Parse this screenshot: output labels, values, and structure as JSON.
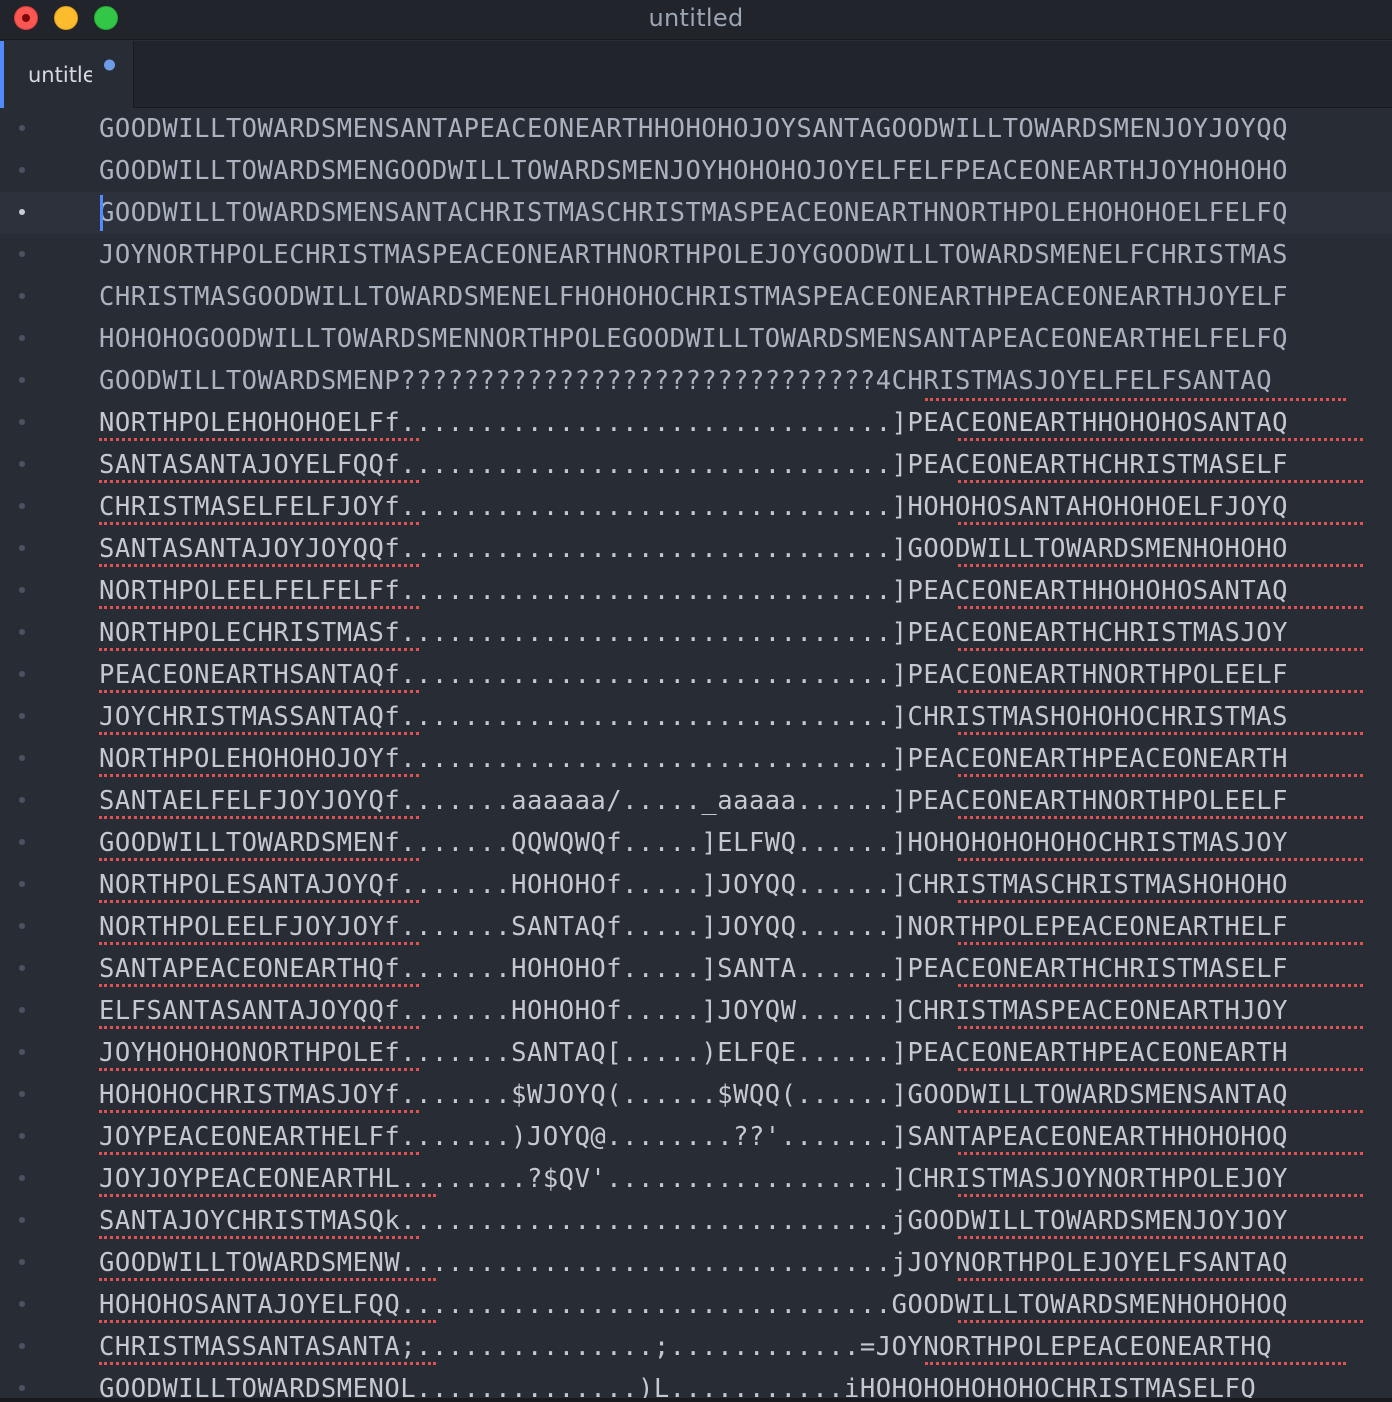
{
  "window": {
    "title": "untitled"
  },
  "tabs": [
    {
      "label": "untitled",
      "modified": true
    }
  ],
  "editor": {
    "current_line": 3,
    "lines": [
      "GOODWILLTOWARDSMENSANTAPEACEONEARTHHOHOHOJOYSANTAGOODWILLTOWARDSMENJOYJOYQQ",
      "GOODWILLTOWARDSMENGOODWILLTOWARDSMENJOYHOHOHOJOYELFELFPEACEONEARTHJOYHOHOHO",
      "GOODWILLTOWARDSMENSANTACHRISTMASCHRISTMASPEACEONEARTHNORTHPOLEHOHOHOELFELFQ",
      "JOYNORTHPOLECHRISTMASPEACEONEARTHNORTHPOLEJOYGOODWILLTOWARDSMENELFCHRISTMAS",
      "CHRISTMASGOODWILLTOWARDSMENELFHOHOHOCHRISTMASPEACEONEARTHPEACEONEARTHJOYELF",
      "HOHOHOGOODWILLTOWARDSMENNORTHPOLEGOODWILLTOWARDSMENSANTAPEACEONEARTHELFELFQ",
      "GOODWILLTOWARDSMENP??????????????????????????????4CHRISTMASJOYELFELFSANTAQ",
      "NORTHPOLEHOHOHOELFf...............................]PEACEONEARTHHOHOHOSANTAQ",
      "SANTASANTAJOYELFQQf...............................]PEACEONEARTHCHRISTMASELF",
      "CHRISTMASELFELFJOYf...............................]HOHOHOSANTAHOHOHOELFJOYQ",
      "SANTASANTAJOYJOYQQf...............................]GOODWILLTOWARDSMENHOHOHO",
      "NORTHPOLEELFELFELFf...............................]PEACEONEARTHHOHOHOSANTAQ",
      "NORTHPOLECHRISTMASf...............................]PEACEONEARTHCHRISTMASJOY",
      "PEACEONEARTHSANTAQf...............................]PEACEONEARTHNORTHPOLEELF",
      "JOYCHRISTMASSANTAQf...............................]CHRISTMASHOHOHOCHRISTMAS",
      "NORTHPOLEHOHOHOJOYf...............................]PEACEONEARTHPEACEONEARTH",
      "SANTAELFELFJOYJOYQf.......aaaaaa/....._aaaaa......]PEACEONEARTHNORTHPOLEELF",
      "GOODWILLTOWARDSMENf.......QQWQWQf.....]ELFWQ......]HOHOHOHOHOHOCHRISTMASJOY",
      "NORTHPOLESANTAJOYQf.......HOHOHOf.....]JOYQQ......]CHRISTMASCHRISTMASHOHOHO",
      "NORTHPOLEELFJOYJOYf.......SANTAQf.....]JOYQQ......]NORTHPOLEPEACEONEARTHELF",
      "SANTAPEACEONEARTHQf.......HOHOHOf.....]SANTA......]PEACEONEARTHCHRISTMASELF",
      "ELFSANTASANTAJOYQQf.......HOHOHOf.....]JOYQW......]CHRISTMASPEACEONEARTHJOY",
      "JOYHOHOHONORTHPOLEf.......SANTAQ[.....)ELFQE......]PEACEONEARTHPEACEONEARTH",
      "HOHOHOCHRISTMASJOYf.......$WJOYQ(......$WQQ(......]GOODWILLTOWARDSMENSANTAQ",
      "JOYPEACEONEARTHELFf.......)JOYQ@........??'.......]SANTAPEACEONEARTHHOHOHOQ",
      "JOYJOYPEACEONEARTHL........?$QV'..................]CHRISTMASJOYNORTHPOLEJOY",
      "SANTAJOYCHRISTMASQk...............................jGOODWILLTOWARDSMENJOYJOY",
      "GOODWILLTOWARDSMENW...............................jJOYNORTHPOLEJOYELFSANTAQ",
      "HOHOHOSANTAJOYELFQQ...............................GOODWILLTOWARDSMENHOHOHOQ",
      "CHRISTMASSANTASANTA;...............;............=JOYNORTHPOLEPEACEONEARTHQ",
      "GOODWILLTOWARDSMENOL..............)L...........iHOHOHOHOHOHOCHRISTMASELFQ"
    ]
  },
  "colors": {
    "background": "#282c34",
    "chrome": "#21252b",
    "text": "#abb2bf",
    "accent": "#528bff",
    "spell_error": "#e05252"
  },
  "icons": {
    "close": "close-icon",
    "minimize": "minimize-icon",
    "maximize": "maximize-icon",
    "modified": "modified-dot-icon"
  }
}
